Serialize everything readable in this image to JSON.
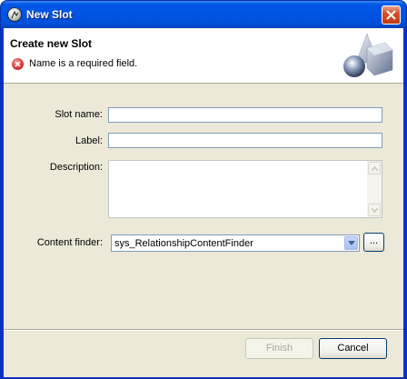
{
  "window": {
    "title": "New Slot"
  },
  "header": {
    "title": "Create new Slot",
    "message": "Name is a required field."
  },
  "form": {
    "slot_name": {
      "label": "Slot name:",
      "value": ""
    },
    "label": {
      "label": "Label:",
      "value": ""
    },
    "description": {
      "label": "Description:",
      "value": ""
    },
    "content_finder": {
      "label": "Content finder:",
      "selected": "sys_RelationshipContentFinder",
      "browse_label": "..."
    }
  },
  "buttons": {
    "finish": "Finish",
    "cancel": "Cancel"
  },
  "colors": {
    "titlebar": "#0054e3",
    "dialog_bg": "#ece9d8",
    "error": "#d83a3a"
  },
  "icons": {
    "window": "app-icon",
    "close": "close-icon",
    "error": "error-icon",
    "wizard": "wizard-banner-icon",
    "dropdown": "chevron-down-icon"
  }
}
